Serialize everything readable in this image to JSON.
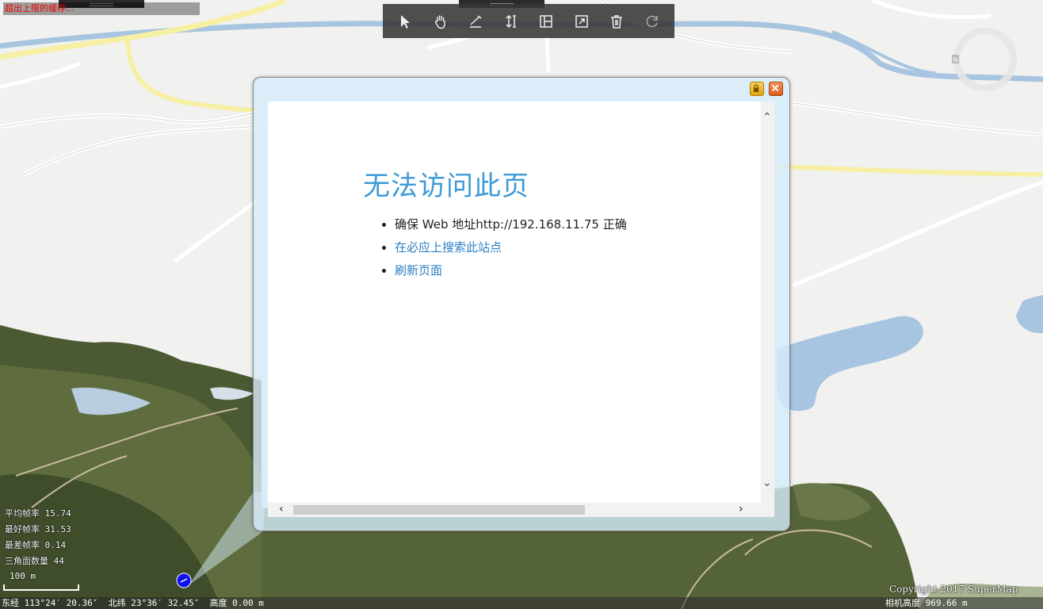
{
  "top_left_label": "超出上限的缓存...",
  "toolbar": {
    "tools": [
      {
        "icon": "pointer-icon"
      },
      {
        "icon": "pan-hand-icon"
      },
      {
        "icon": "measure-distance-icon"
      },
      {
        "icon": "measure-height-icon"
      },
      {
        "icon": "measure-area-icon"
      },
      {
        "icon": "fullscreen-icon"
      },
      {
        "icon": "trash-icon"
      },
      {
        "icon": "refresh-icon"
      }
    ]
  },
  "popup": {
    "error_title": "无法访问此页",
    "bullets": [
      {
        "text": "确保 Web 地址http://192.168.11.75 正确",
        "link": false
      },
      {
        "text": "在必应上搜索此站点",
        "link": true
      },
      {
        "text": "刷新页面",
        "link": true
      }
    ]
  },
  "stats": {
    "avg_fps": "平均帧率 15.74",
    "best_fps": "最好帧率 31.53",
    "worst_fps": "最差帧率 0.14",
    "triangles": "三角面数量 44"
  },
  "scale": {
    "label": "100 m"
  },
  "status": {
    "coords": "东经 113°24′ 20.36″  北纬 23°36′ 32.45″  高度 0.00 m",
    "camera_height": "相机高度 969.66 m"
  },
  "copyright": "Copyright 2017 SuperMap",
  "colors": {
    "accent": "#3e9ad6",
    "link": "#2b7ec3",
    "water": "#a7c4e0",
    "major_road": "#f7f0a4"
  }
}
